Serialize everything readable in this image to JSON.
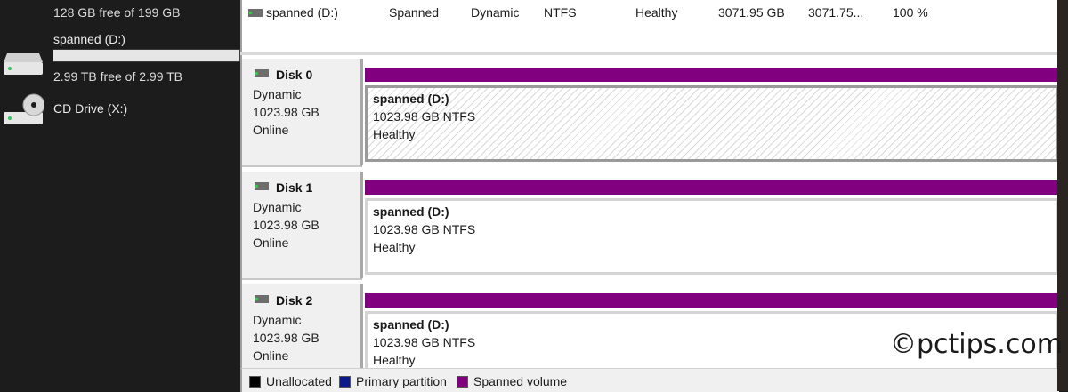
{
  "explorer": {
    "drive_c_free": "128 GB free of 199 GB",
    "drive_d": {
      "label": "spanned (D:)",
      "free": "2.99 TB free of 2.99 TB",
      "used_fraction": 0.0
    },
    "drive_x": {
      "label": "CD Drive (X:)"
    }
  },
  "volume_list": {
    "row": {
      "volume": "spanned (D:)",
      "layout": "Spanned",
      "type": "Dynamic",
      "file_system": "NTFS",
      "status": "Healthy",
      "capacity": "3071.95 GB",
      "free_space": "3071.75...",
      "percent_free": "100 %"
    }
  },
  "disks": [
    {
      "title": "Disk 0",
      "type": "Dynamic",
      "size": "1023.98 GB",
      "state": "Online",
      "volume": {
        "name": "spanned  (D:)",
        "size_fs": "1023.98 GB NTFS",
        "status": "Healthy"
      }
    },
    {
      "title": "Disk 1",
      "type": "Dynamic",
      "size": "1023.98 GB",
      "state": "Online",
      "volume": {
        "name": "spanned  (D:)",
        "size_fs": "1023.98 GB NTFS",
        "status": "Healthy"
      }
    },
    {
      "title": "Disk 2",
      "type": "Dynamic",
      "size": "1023.98 GB",
      "state": "Online",
      "volume": {
        "name": "spanned  (D:)",
        "size_fs": "1023.98 GB NTFS",
        "status": "Healthy"
      }
    }
  ],
  "legend": {
    "unallocated": {
      "label": "Unallocated",
      "color": "#000000"
    },
    "primary": {
      "label": "Primary partition",
      "color": "#0a1a8a"
    },
    "spanned": {
      "label": "Spanned volume",
      "color": "#800080"
    }
  },
  "colors": {
    "spanned_strip": "#800080"
  },
  "watermark": "©pctips.com"
}
